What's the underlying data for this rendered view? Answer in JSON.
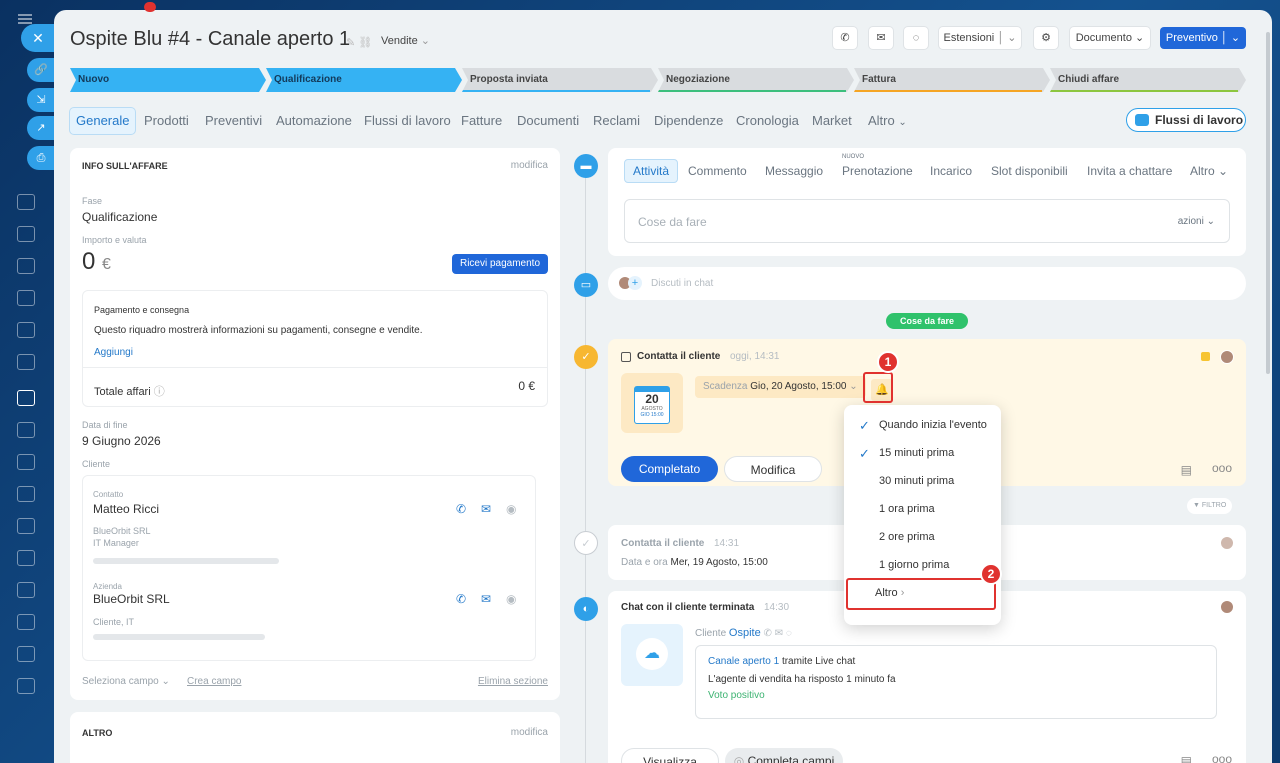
{
  "deal": {
    "title": "Ospite Blu #4 - Canale aperto 1",
    "category": "Vendite"
  },
  "toolbar": {
    "estensioni": "Estensioni",
    "documento": "Documento",
    "preventivo": "Preventivo"
  },
  "stages": [
    {
      "label": "Nuovo",
      "state": "done"
    },
    {
      "label": "Qualificazione",
      "state": "done"
    },
    {
      "label": "Proposta inviata",
      "state": "todo",
      "color": "#35b2f3"
    },
    {
      "label": "Negoziazione",
      "state": "todo",
      "color": "#3cbf7d"
    },
    {
      "label": "Fattura",
      "state": "todo",
      "color": "#f5a524"
    },
    {
      "label": "Chiudi affare",
      "state": "todo",
      "color": "#8cc63f"
    }
  ],
  "tabs": [
    "Generale",
    "Prodotti",
    "Preventivi",
    "Automazione",
    "Flussi di lavoro",
    "Fatture",
    "Documenti",
    "Reclami",
    "Dipendenze",
    "Cronologia",
    "Market",
    "Altro"
  ],
  "flussi_button": "Flussi di lavoro",
  "info": {
    "header": "INFO SULL'AFFARE",
    "edit": "modifica",
    "fase_label": "Fase",
    "fase": "Qualificazione",
    "importo_label": "Importo e valuta",
    "importo": "0",
    "currency": "€",
    "ricevi": "Ricevi pagamento",
    "pagamento_title": "Pagamento e consegna",
    "pagamento_desc": "Questo riquadro mostrerà informazioni su pagamenti, consegne e vendite.",
    "aggiungi": "Aggiungi",
    "totale_label": "Totale affari",
    "totale": "0 €",
    "data_fine_label": "Data di fine",
    "data_fine": "9 Giugno 2026",
    "cliente_label": "Cliente",
    "contatto_label": "Contatto",
    "contatto": "Matteo Ricci",
    "contatto_company": "BlueOrbit SRL",
    "contatto_role": "IT Manager",
    "azienda_label": "Azienda",
    "azienda": "BlueOrbit SRL",
    "azienda_sub": "Cliente, IT",
    "seleziona": "Seleziona campo",
    "crea": "Crea campo",
    "elimina": "Elimina sezione",
    "altro_header": "ALTRO",
    "altro_edit": "modifica"
  },
  "activity_tabs": {
    "active": "Attività",
    "items": [
      "Commento",
      "Messaggio",
      "Prenotazione",
      "Incarico",
      "Slot disponibili",
      "Invita a chattare",
      "Altro"
    ],
    "nuovo": "NUOVO"
  },
  "todo_input": {
    "placeholder": "Cose da fare",
    "azioni": "azioni"
  },
  "chat_input": {
    "placeholder": "Discuti in chat"
  },
  "cose_badge": "Cose da fare",
  "task": {
    "title": "Contatta il cliente",
    "time": "oggi, 14:31",
    "cal_day": "20",
    "cal_month": "AGOSTO",
    "cal_sub": "GIO 15:00",
    "scadenza_label": "Scadenza",
    "scadenza": "Gio, 20 Agosto, 15:00",
    "completato": "Completato",
    "modifica": "Modifica"
  },
  "filtro": "FILTRO",
  "history1": {
    "title": "Contatta il cliente",
    "time": "14:31",
    "detail_label": "Data e ora",
    "detail": "Mer, 19 Agosto, 15:00"
  },
  "history2": {
    "title": "Chat con il cliente terminata",
    "time": "14:30",
    "cliente_label": "Cliente",
    "ospite": "Ospite",
    "canale": "Canale aperto 1",
    "tramite": "tramite Live chat",
    "agente": "L'agente di vendita ha risposto 1 minuto fa",
    "voto": "Voto positivo",
    "visualizza": "Visualizza",
    "completa": "Completa campi"
  },
  "menu": {
    "items": [
      {
        "label": "Quando inizia l'evento",
        "checked": true
      },
      {
        "label": "15 minuti prima",
        "checked": true
      },
      {
        "label": "30 minuti prima",
        "checked": false
      },
      {
        "label": "1 ora prima",
        "checked": false
      },
      {
        "label": "2 ore prima",
        "checked": false
      },
      {
        "label": "1 giorno prima",
        "checked": false
      },
      {
        "label": "Altro",
        "checked": false
      }
    ]
  },
  "badges": {
    "one": "1",
    "two": "2"
  }
}
